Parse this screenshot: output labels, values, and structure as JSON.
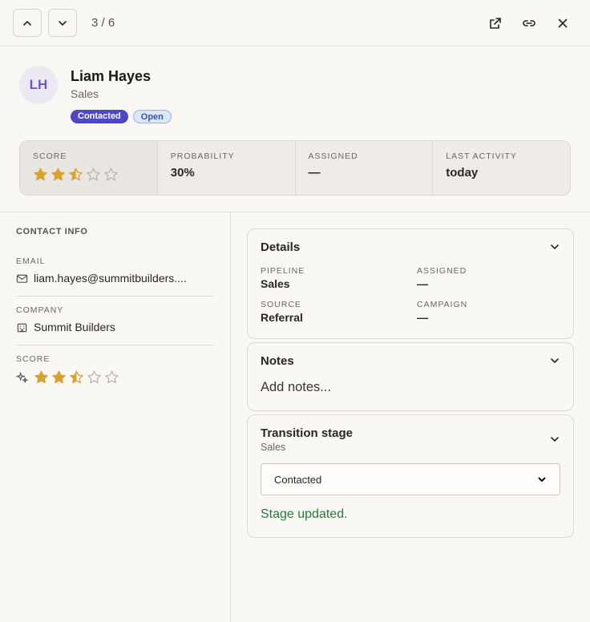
{
  "nav": {
    "counter": "3 / 6",
    "prev_icon": "chevron-up-icon",
    "next_icon": "chevron-down-icon",
    "actions": [
      "external-link-icon",
      "link-icon",
      "close-icon"
    ]
  },
  "contact": {
    "initials": "LH",
    "name": "Liam Hayes",
    "department": "Sales",
    "badges": [
      "Contacted",
      "Open"
    ]
  },
  "stats": {
    "score_label": "SCORE",
    "score_value": 2.5,
    "score_max": 5,
    "probability_label": "PROBABILITY",
    "probability_value": "30%",
    "assigned_label": "ASSIGNED",
    "assigned_value": "—",
    "last_activity_label": "LAST ACTIVITY",
    "last_activity_value": "today"
  },
  "sidebar": {
    "title": "CONTACT INFO",
    "email_label": "EMAIL",
    "email_value": "liam.hayes@summitbuilders....",
    "company_label": "COMPANY",
    "company_value": "Summit Builders",
    "score_label": "SCORE",
    "score_value": 2.5
  },
  "details": {
    "title": "Details",
    "pipeline_label": "PIPELINE",
    "pipeline_value": "Sales",
    "assigned_label": "ASSIGNED",
    "assigned_value": "—",
    "source_label": "SOURCE",
    "source_value": "Referral",
    "campaign_label": "CAMPAIGN",
    "campaign_value": "—"
  },
  "notes": {
    "title": "Notes",
    "placeholder": "Add notes..."
  },
  "transition": {
    "title": "Transition stage",
    "subtitle": "Sales",
    "selected": "Contacted",
    "status": "Stage updated."
  },
  "colors": {
    "accent": "#4f46c8",
    "star": "#d9a12e",
    "success": "#237a3a"
  }
}
